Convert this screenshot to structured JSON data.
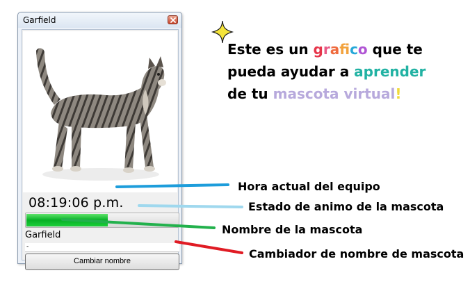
{
  "window": {
    "title": "Garfield",
    "clock_text": "08:19:06 p.m.",
    "mood_level_percent": 53,
    "pet_name": "Garfield",
    "name_input_value": "-",
    "change_name_button_label": "Cambiar nombre"
  },
  "headline": {
    "line1": [
      {
        "text": "Este es un ",
        "color": "#000000"
      },
      {
        "text": "g",
        "color": "#e6354a"
      },
      {
        "text": "r",
        "color": "#e95a86"
      },
      {
        "text": "a",
        "color": "#ef6a3d"
      },
      {
        "text": "f",
        "color": "#f2a23c"
      },
      {
        "text": "i",
        "color": "#5fbf4a"
      },
      {
        "text": "c",
        "color": "#27a8d8"
      },
      {
        "text": "o",
        "color": "#b055d4"
      },
      {
        "text": " que te",
        "color": "#000000"
      }
    ],
    "line2": [
      {
        "text": "pueda ayudar a ",
        "color": "#000000"
      },
      {
        "text": "aprender",
        "color": "#21b2a3"
      }
    ],
    "line3": [
      {
        "text": "de tu ",
        "color": "#000000"
      },
      {
        "text": "mascota virtual",
        "color": "#b7a9dc"
      },
      {
        "text": "!",
        "color": "#f0d93c"
      }
    ]
  },
  "annotations": {
    "clock": "Hora actual del equipo",
    "mood": "Estado de animo de la mascota",
    "name": "Nombre de la mascota",
    "changer": "Cambiador de nombre de mascota"
  },
  "colors": {
    "clock_line": "#1d9ddb",
    "mood_line": "#9fd8ee",
    "name_line": "#22b14c",
    "changer_line": "#e01b24",
    "sparkle": "#f5e43a"
  },
  "icons": {
    "close": "close-icon",
    "sparkle": "sparkle-icon",
    "pet": "cat-image"
  }
}
